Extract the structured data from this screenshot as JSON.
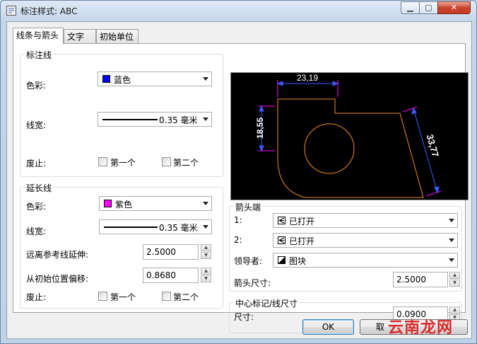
{
  "window": {
    "title": "标注样式: ABC"
  },
  "tabs": [
    {
      "label": "线条与箭头"
    },
    {
      "label": "文字"
    },
    {
      "label": "初始单位"
    }
  ],
  "dim_line": {
    "group_label": "标注线",
    "color_label": "色彩:",
    "color_value": "蓝色",
    "color_hex": "#0000ff",
    "lineweight_label": "线宽:",
    "lineweight_value": "0.35 毫米",
    "suppress_label": "废止:",
    "first_label": "第一个",
    "second_label": "第二个"
  },
  "ext_line": {
    "group_label": "延长线",
    "color_label": "色彩:",
    "color_value": "紫色",
    "color_hex": "#ff00ff",
    "lineweight_label": "线宽:",
    "lineweight_value": "0.35 毫米",
    "extend_label": "远离参考线延伸:",
    "extend_value": "2.5000",
    "offset_label": "从初始位置偏移:",
    "offset_value": "0.8680",
    "suppress_label": "废止:",
    "first_label": "第一个",
    "second_label": "第二个"
  },
  "arrowheads": {
    "group_label": "箭头端",
    "first_label": "1:",
    "first_value": "已打开",
    "second_label": "2:",
    "second_value": "已打开",
    "leader_label": "领导者:",
    "leader_value": "图块",
    "size_label": "箭头尺寸:",
    "size_value": "2.5000"
  },
  "center_mark": {
    "group_label": "中心标记/线尺寸",
    "size_label": "尺寸:",
    "size_value": "0.0900"
  },
  "preview": {
    "dim_top": "23,19",
    "dim_left": "18,55",
    "dim_right": "33,77"
  },
  "buttons": {
    "ok": "OK",
    "cancel": "取"
  },
  "watermark": {
    "text": "云南龙网"
  }
}
